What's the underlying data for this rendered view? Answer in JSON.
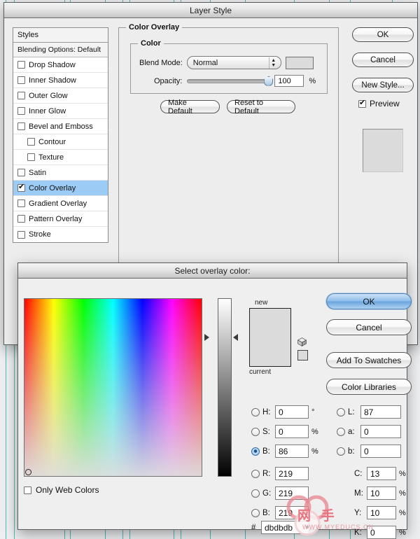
{
  "layer_style": {
    "title": "Layer Style",
    "styles_panel": {
      "header": "Styles",
      "blending_options": "Blending Options: Default",
      "items": [
        {
          "label": "Drop Shadow",
          "checked": false,
          "indent": false,
          "selected": false
        },
        {
          "label": "Inner Shadow",
          "checked": false,
          "indent": false,
          "selected": false
        },
        {
          "label": "Outer Glow",
          "checked": false,
          "indent": false,
          "selected": false
        },
        {
          "label": "Inner Glow",
          "checked": false,
          "indent": false,
          "selected": false
        },
        {
          "label": "Bevel and Emboss",
          "checked": false,
          "indent": false,
          "selected": false
        },
        {
          "label": "Contour",
          "checked": false,
          "indent": true,
          "selected": false
        },
        {
          "label": "Texture",
          "checked": false,
          "indent": true,
          "selected": false
        },
        {
          "label": "Satin",
          "checked": false,
          "indent": false,
          "selected": false
        },
        {
          "label": "Color Overlay",
          "checked": true,
          "indent": false,
          "selected": true
        },
        {
          "label": "Gradient Overlay",
          "checked": false,
          "indent": false,
          "selected": false
        },
        {
          "label": "Pattern Overlay",
          "checked": false,
          "indent": false,
          "selected": false
        },
        {
          "label": "Stroke",
          "checked": false,
          "indent": false,
          "selected": false
        }
      ]
    },
    "color_overlay": {
      "section_legend": "Color Overlay",
      "sub_legend": "Color",
      "blend_mode_label": "Blend Mode:",
      "blend_mode_value": "Normal",
      "overlay_swatch_color": "#dbdbdb",
      "opacity_label": "Opacity:",
      "opacity_value": "100",
      "opacity_unit": "%",
      "make_default": "Make Default",
      "reset_to_default": "Reset to Default"
    },
    "buttons": {
      "ok": "OK",
      "cancel": "Cancel",
      "new_style": "New Style...",
      "preview_label": "Preview",
      "preview_checked": true,
      "preview_swatch_color": "#dbdbdb"
    }
  },
  "color_picker": {
    "title": "Select overlay color:",
    "buttons": {
      "ok": "OK",
      "cancel": "Cancel",
      "add_to_swatches": "Add To Swatches",
      "color_libraries": "Color Libraries"
    },
    "swatch": {
      "new_label": "new",
      "current_label": "current",
      "new_color": "#dbdbdb",
      "current_color": "#dbdbdb",
      "web_safe_color": "#dbdbdb"
    },
    "only_web_colors_label": "Only Web Colors",
    "only_web_colors_checked": false,
    "hsb": [
      {
        "key": "H",
        "label": "H:",
        "value": "0",
        "unit": "°",
        "selected": false
      },
      {
        "key": "S",
        "label": "S:",
        "value": "0",
        "unit": "%",
        "selected": false
      },
      {
        "key": "B",
        "label": "B:",
        "value": "86",
        "unit": "%",
        "selected": true
      }
    ],
    "lab": [
      {
        "key": "L",
        "label": "L:",
        "value": "87",
        "unit": "",
        "selected": false
      },
      {
        "key": "a",
        "label": "a:",
        "value": "0",
        "unit": "",
        "selected": false
      },
      {
        "key": "b",
        "label": "b:",
        "value": "0",
        "unit": "",
        "selected": false
      }
    ],
    "rgb": [
      {
        "key": "R",
        "label": "R:",
        "value": "219",
        "unit": "",
        "selected": false
      },
      {
        "key": "G",
        "label": "G:",
        "value": "219",
        "unit": "",
        "selected": false
      },
      {
        "key": "B",
        "label": "B:",
        "value": "219",
        "unit": "",
        "selected": false
      }
    ],
    "cmyk": [
      {
        "key": "C",
        "label": "C:",
        "value": "13",
        "unit": "%"
      },
      {
        "key": "M",
        "label": "M:",
        "value": "10",
        "unit": "%"
      },
      {
        "key": "Y",
        "label": "Y:",
        "value": "10",
        "unit": "%"
      },
      {
        "key": "K",
        "label": "K:",
        "value": "0",
        "unit": "%"
      }
    ],
    "hex": {
      "prefix": "#",
      "value": "dbdbdb"
    }
  },
  "watermark": {
    "text": "网 手",
    "url": "WWW.MYEDUCS.CN",
    "color": "#e8737f"
  }
}
